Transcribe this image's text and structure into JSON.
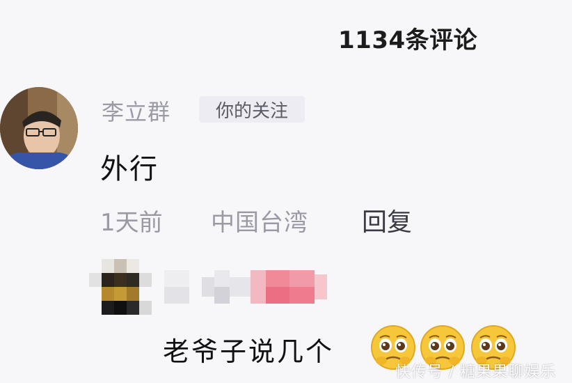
{
  "header": {
    "comment_count": "1134条评论"
  },
  "comment": {
    "author": "李立群",
    "follow_tag": "你的关注",
    "text": "外行",
    "time": "1天前",
    "location": "中国台湾",
    "reply_label": "回复"
  },
  "reply": {
    "text": "老爷子说几个",
    "emoji_icons": [
      "pleading-face-icon",
      "pleading-face-icon",
      "pleading-face-icon"
    ]
  },
  "watermark": "快传号 / 糖果果聊娱乐",
  "colors": {
    "background": "#f7f7fa",
    "meta_gray": "#9a9aa5",
    "tag_bg": "#ececf2",
    "emoji_yellow": "#f6c73a"
  }
}
